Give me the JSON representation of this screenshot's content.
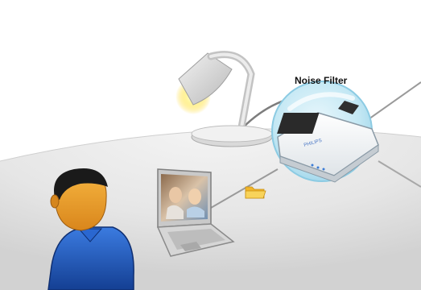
{
  "callout": {
    "label": "Noise Filter"
  },
  "device": {
    "brand_text": "PHILIPS"
  },
  "icons": [
    "desk-lamp-icon",
    "folder-icon",
    "user-icon",
    "laptop-icon",
    "noise-filter-device-icon",
    "power-plug-icon"
  ],
  "colors": {
    "bubble": "#bfe6f3",
    "bubble_border": "#8ccbe3",
    "folder": "#f5c53a",
    "person_shirt": "#1d55b9",
    "person_skin": "#e89a2a",
    "lamp_light": "#ffe24a"
  }
}
